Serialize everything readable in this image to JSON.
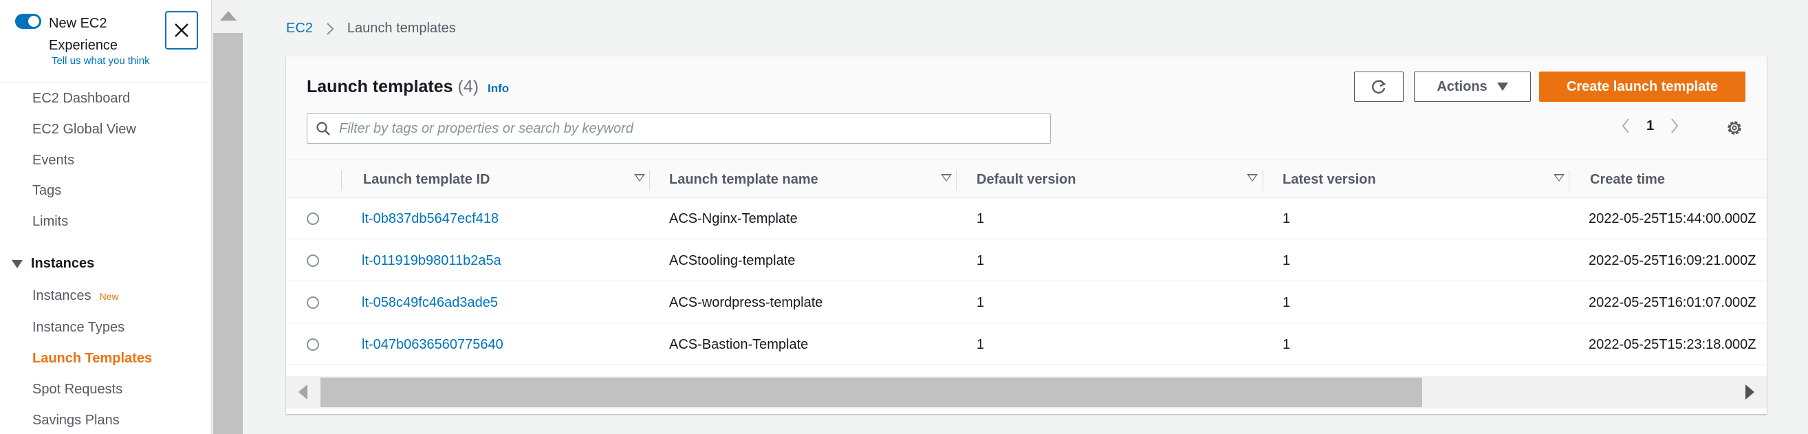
{
  "sidebar": {
    "toggle_label": "New EC2 Experience",
    "feedback_link": "Tell us what you think",
    "items": [
      {
        "label": "EC2 Dashboard"
      },
      {
        "label": "EC2 Global View"
      },
      {
        "label": "Events"
      },
      {
        "label": "Tags"
      },
      {
        "label": "Limits"
      }
    ],
    "section": {
      "label": "Instances",
      "items": [
        {
          "label": "Instances",
          "badge": "New"
        },
        {
          "label": "Instance Types"
        },
        {
          "label": "Launch Templates",
          "active": true
        },
        {
          "label": "Spot Requests"
        },
        {
          "label": "Savings Plans"
        }
      ]
    }
  },
  "breadcrumb": {
    "root": "EC2",
    "current": "Launch templates"
  },
  "panel": {
    "title": "Launch templates",
    "count": "(4)",
    "info_link": "Info",
    "actions_label": "Actions",
    "create_label": "Create launch template",
    "search_placeholder": "Filter by tags or properties or search by keyword",
    "page_number": "1"
  },
  "table": {
    "columns": [
      "Launch template ID",
      "Launch template name",
      "Default version",
      "Latest version",
      "Create time"
    ],
    "rows": [
      {
        "id": "lt-0b837db5647ecf418",
        "name": "ACS-Nginx-Template",
        "default_version": "1",
        "latest_version": "1",
        "create_time": "2022-05-25T15:44:00.000Z"
      },
      {
        "id": "lt-011919b98011b2a5a",
        "name": "ACStooling-template",
        "default_version": "1",
        "latest_version": "1",
        "create_time": "2022-05-25T16:09:21.000Z"
      },
      {
        "id": "lt-058c49fc46ad3ade5",
        "name": "ACS-wordpress-template",
        "default_version": "1",
        "latest_version": "1",
        "create_time": "2022-05-25T16:01:07.000Z"
      },
      {
        "id": "lt-047b0636560775640",
        "name": "ACS-Bastion-Template",
        "default_version": "1",
        "latest_version": "1",
        "create_time": "2022-05-25T15:23:18.000Z"
      }
    ]
  },
  "colors": {
    "accent": "#ec7211",
    "link": "#0073bb"
  }
}
